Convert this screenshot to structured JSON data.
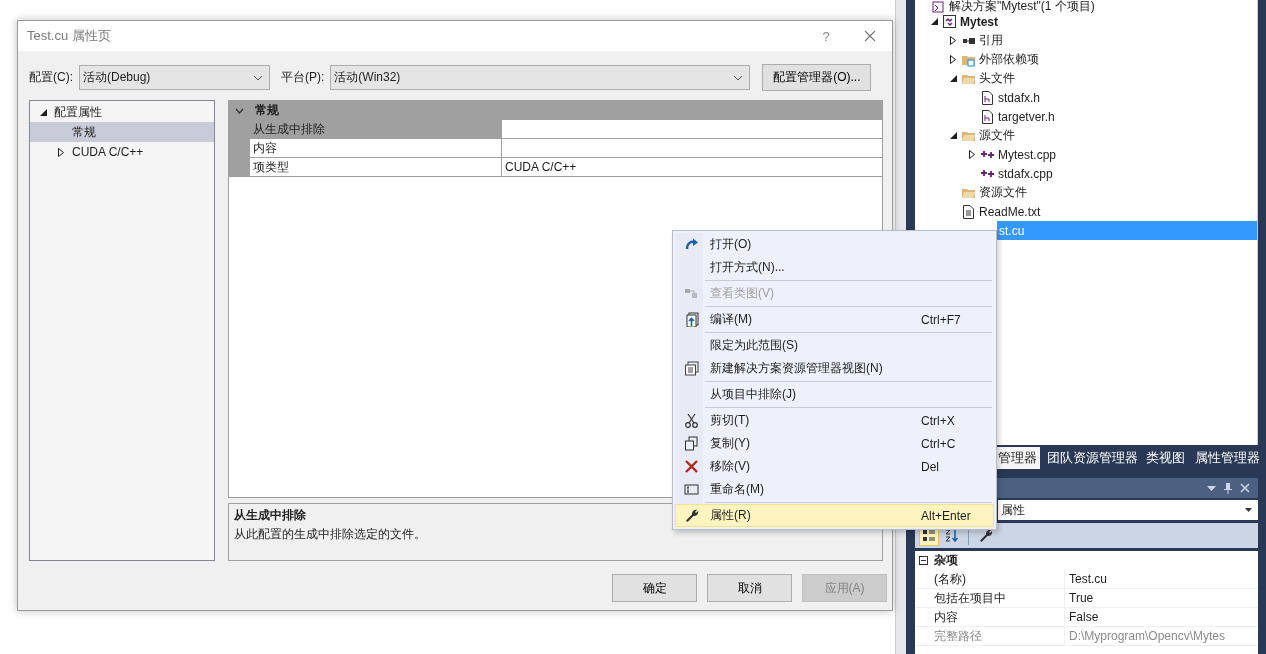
{
  "dialog": {
    "title": "Test.cu 属性页",
    "help": "?",
    "config_label": "配置(C):",
    "config_value": "活动(Debug)",
    "platform_label": "平台(P):",
    "platform_value": "活动(Win32)",
    "manager_button": "配置管理器(O)...",
    "tree": [
      {
        "label": "配置属性",
        "expanded": true,
        "selected": false,
        "children": [
          {
            "label": "常规",
            "selected": true
          },
          {
            "label": "CUDA C/C++",
            "expanded": false,
            "selected": false
          }
        ]
      }
    ],
    "grid": {
      "category": "常规",
      "expanded": true,
      "rows": [
        {
          "name": "从生成中排除",
          "selected": true
        },
        {
          "name": "内容",
          "selected": false
        },
        {
          "name": "项类型",
          "value": "CUDA C/C++",
          "selected": false
        }
      ]
    },
    "description": {
      "title": "从生成中排除",
      "text": "从此配置的生成中排除选定的文件。"
    },
    "buttons": [
      {
        "label": "确定",
        "disabled": false
      },
      {
        "label": "取消",
        "disabled": false
      },
      {
        "label": "应用(A)",
        "disabled": true
      }
    ]
  },
  "context_menu": [
    {
      "kind": "item",
      "label": "打开(O)",
      "disabled": false,
      "selected": false
    },
    {
      "kind": "item",
      "label": "打开方式(N)...",
      "disabled": false,
      "selected": false
    },
    {
      "kind": "separator"
    },
    {
      "kind": "item",
      "label": "查看类图(V)",
      "disabled": true,
      "selected": false
    },
    {
      "kind": "separator"
    },
    {
      "kind": "item",
      "label": "编译(M)",
      "shortcut": "Ctrl+F7",
      "disabled": false,
      "selected": false
    },
    {
      "kind": "separator"
    },
    {
      "kind": "item",
      "label": "限定为此范围(S)",
      "disabled": false,
      "selected": false
    },
    {
      "kind": "item",
      "label": "新建解决方案资源管理器视图(N)",
      "disabled": false,
      "selected": false
    },
    {
      "kind": "separator"
    },
    {
      "kind": "item",
      "label": "从项目中排除(J)",
      "disabled": false,
      "selected": false
    },
    {
      "kind": "separator"
    },
    {
      "kind": "item",
      "label": "剪切(T)",
      "shortcut": "Ctrl+X",
      "disabled": false,
      "selected": false
    },
    {
      "kind": "item",
      "label": "复制(Y)",
      "shortcut": "Ctrl+C",
      "disabled": false,
      "selected": false
    },
    {
      "kind": "item",
      "label": "移除(V)",
      "shortcut": "Del",
      "disabled": false,
      "selected": false
    },
    {
      "kind": "item",
      "label": "重命名(M)",
      "disabled": false,
      "selected": false
    },
    {
      "kind": "separator"
    },
    {
      "kind": "item",
      "label": "属性(R)",
      "shortcut": "Alt+Enter",
      "disabled": false,
      "selected": true
    }
  ],
  "explorer": {
    "tree": [
      {
        "kind": "solution",
        "label": "解决方案\"Mytest\"(1 个项目)",
        "selected": false,
        "children": [
          {
            "kind": "project",
            "label": "Mytest",
            "expanded": true,
            "selected": false,
            "children": [
              {
                "kind": "references",
                "label": "引用",
                "expanded": false,
                "selected": false
              },
              {
                "kind": "dependencies",
                "label": "外部依赖项",
                "expanded": false,
                "selected": false
              },
              {
                "kind": "folder",
                "label": "头文件",
                "expanded": true,
                "selected": false,
                "children": [
                  {
                    "kind": "header",
                    "label": "stdafx.h",
                    "selected": false
                  },
                  {
                    "kind": "header",
                    "label": "targetver.h",
                    "selected": false
                  }
                ]
              },
              {
                "kind": "folder",
                "label": "源文件",
                "expanded": true,
                "selected": false,
                "children": [
                  {
                    "kind": "source",
                    "label": "Mytest.cpp",
                    "expanded": false,
                    "selected": false
                  },
                  {
                    "kind": "source",
                    "label": "stdafx.cpp",
                    "selected": false
                  }
                ]
              },
              {
                "kind": "folder",
                "label": "资源文件",
                "selected": false
              },
              {
                "kind": "text",
                "label": "ReadMe.txt",
                "selected": false
              },
              {
                "kind": "covered",
                "label": "st.cu",
                "selected": true
              }
            ]
          }
        ]
      }
    ]
  },
  "tabs": [
    {
      "label": "管理器",
      "selected": true
    },
    {
      "label": "团队资源管理器",
      "selected": false
    },
    {
      "label": "类视图",
      "selected": false
    },
    {
      "label": "属性管理器",
      "selected": false
    }
  ],
  "properties": {
    "selector": "属性",
    "toolbar": [
      {
        "selected": true
      },
      {
        "selected": false
      },
      {
        "selected": false
      }
    ],
    "category": "杂项",
    "expanded": true,
    "rows": [
      {
        "name": "(名称)",
        "value": "Test.cu",
        "readonly": false
      },
      {
        "name": "包括在项目中",
        "value": "True",
        "readonly": false
      },
      {
        "name": "内容",
        "value": "False",
        "readonly": false
      },
      {
        "name": "完整路径",
        "value": "D:\\Myprogram\\Opencv\\Mytes",
        "readonly": true
      }
    ]
  }
}
